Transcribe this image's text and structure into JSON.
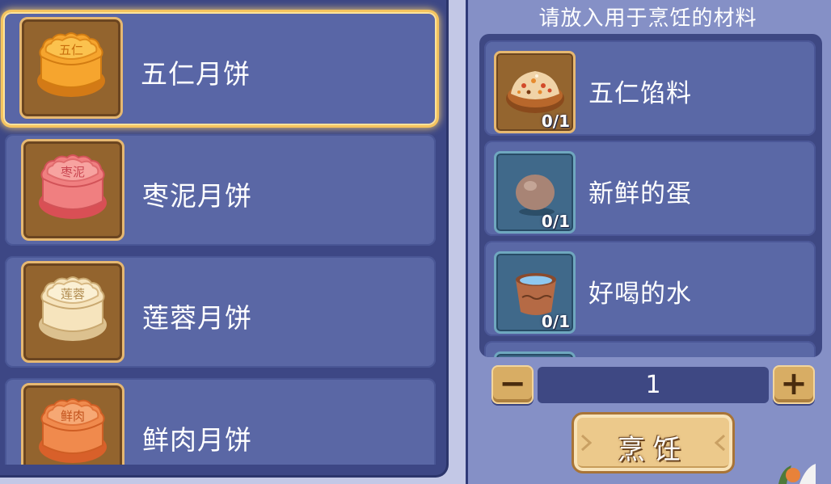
{
  "recipes": [
    {
      "name": "五仁月饼",
      "stamp": "五仁",
      "selected": true,
      "color": "#f2a334"
    },
    {
      "name": "枣泥月饼",
      "stamp": "枣泥",
      "selected": false,
      "color": "#ef7f7f"
    },
    {
      "name": "莲蓉月饼",
      "stamp": "莲蓉",
      "selected": false,
      "color": "#f4ddb0"
    },
    {
      "name": "鲜肉月饼",
      "stamp": "鲜肉",
      "selected": false,
      "color": "#f08a4d"
    }
  ],
  "materials_panel": {
    "title": "请放入用于烹饪的材料",
    "items": [
      {
        "name": "五仁馅料",
        "count": "0/1",
        "icon": "nut-filling-icon"
      },
      {
        "name": "新鲜的蛋",
        "count": "0/1",
        "icon": "egg-icon"
      },
      {
        "name": "好喝的水",
        "count": "0/1",
        "icon": "water-bucket-icon"
      }
    ]
  },
  "quantity": {
    "minus": "−",
    "value": "1",
    "plus": "+"
  },
  "cook_button": {
    "label": "烹饪"
  }
}
